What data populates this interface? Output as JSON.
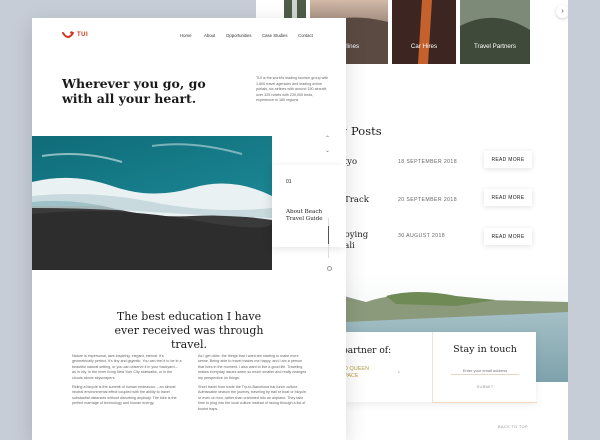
{
  "front": {
    "brand": {
      "name": "TUI",
      "color": "#d4351c",
      "icon": "tui-smile-logo"
    },
    "nav": [
      "Home",
      "About",
      "Opportunities",
      "Case Studies",
      "Contact"
    ],
    "headline": "Wherever you go, go with all your heart.",
    "intro": "TUI is the world's leading tourism group with 1,600 travel agencies and leading online portals, six airlines with around 150 aircraft, over 325 hotels with 239,000 beds, experience in 180 regions.",
    "story": {
      "number": "01",
      "title": "About Beach Travel Guide"
    },
    "quote": "The best education I have ever received was through travel.",
    "columns": {
      "left": [
        "Nature is impersonal, awe-inspiring, elegant, eternal. It's geometrically perfect. It's tiny and gigantic. You can feel it to be in a beautiful natural setting, or you can observe it in your backyard – as in city, in the inner living New York City sidewalks, or in the clouds above skyscrapers.",
        "Riding a bicycle is the summit of human endeavour – an almost neutral environmental effect coupled with the ability to travel substantial distances without disturbing anybody. The bike is the perfect marriage of technology and human energy."
      ],
      "right": [
        "As I get older, the things that I want are starting to make more sense. Being able to travel makes me happy, and I am a person that lives in the moment. I also want to live a good life. Traveling makes everyday issues seem so much smaller and really changes my perspective on things.",
        "Short travel from trade the Try-to-Barcelona bar lunch culture. Admissable season the journey, traveling by trail or boat or bicycle, or even on foot, rather than crammed into an airplane. They take time to plug into the local culture instead of racing through a list of tourist traps."
      ]
    }
  },
  "back": {
    "categories": [
      "Airlines",
      "Car Hires",
      "Travel Partners"
    ],
    "posts_title": "g Posts",
    "posts": [
      {
        "title": "kyo",
        "date": "18 SEPTEMBER 2018",
        "cta": "READ MORE"
      },
      {
        "title": "n Track",
        "date": "20 SEPTEMBER 2018",
        "cta": "READ MORE"
      },
      {
        "title": "joying",
        "title2": "Bali",
        "date": "30 AUGUST 2018",
        "cta": "READ MORE"
      }
    ],
    "partner": {
      "title": "partner of:",
      "name": "D QUEEN",
      "name2": "PACE"
    },
    "stay": {
      "title": "Stay in touch",
      "placeholder": "Enter your email address",
      "submit": "SUBMIT"
    },
    "back_to_top": "BACK TO TOP"
  }
}
